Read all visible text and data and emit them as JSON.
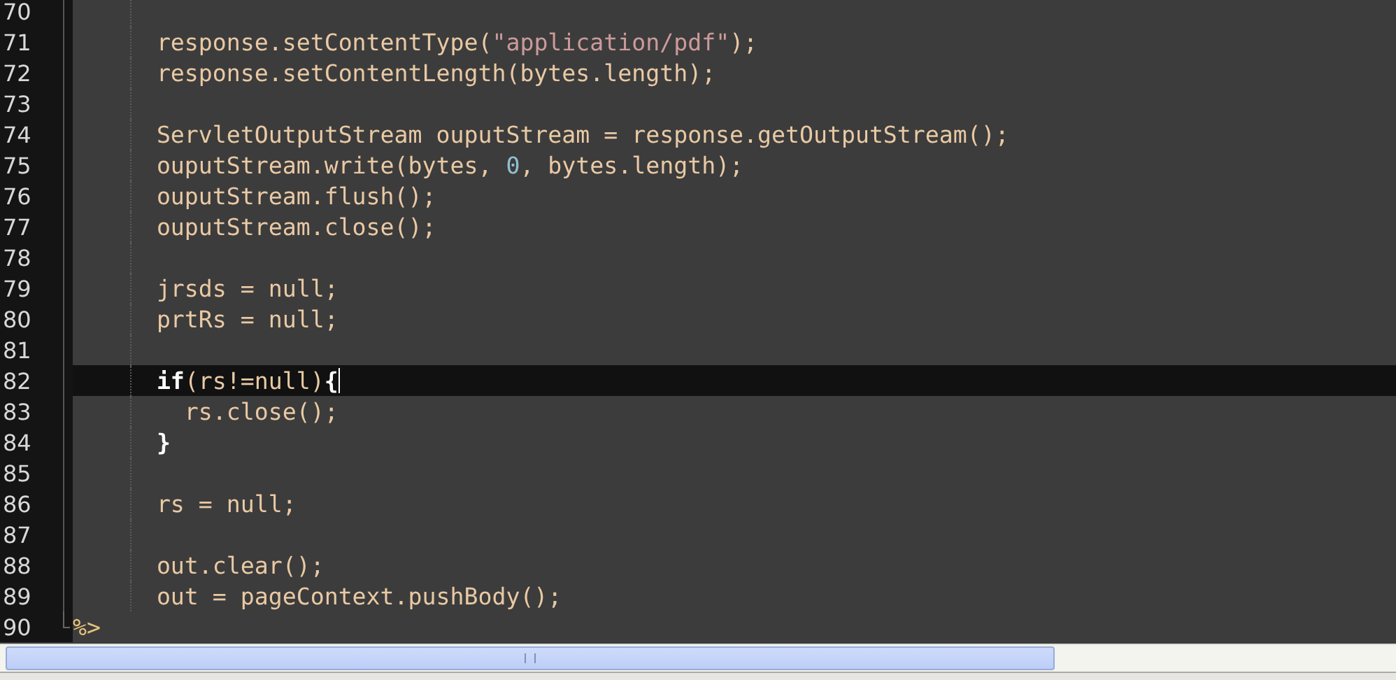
{
  "editor": {
    "lines": [
      {
        "number": "70",
        "current": false
      },
      {
        "number": "71",
        "current": false,
        "tokens": [
          {
            "kind": "plain",
            "text": "      response.setContentType("
          },
          {
            "kind": "string",
            "text": "\"application/pdf\""
          },
          {
            "kind": "plain",
            "text": ");"
          }
        ]
      },
      {
        "number": "72",
        "current": false,
        "tokens": [
          {
            "kind": "plain",
            "text": "      response.setContentLength(bytes.length);"
          }
        ]
      },
      {
        "number": "73",
        "current": false
      },
      {
        "number": "74",
        "current": false,
        "tokens": [
          {
            "kind": "plain",
            "text": "      ServletOutputStream ouputStream = response.getOutputStream();"
          }
        ]
      },
      {
        "number": "75",
        "current": false,
        "tokens": [
          {
            "kind": "plain",
            "text": "      ouputStream.write(bytes, "
          },
          {
            "kind": "number",
            "text": "0"
          },
          {
            "kind": "plain",
            "text": ", bytes.length);"
          }
        ]
      },
      {
        "number": "76",
        "current": false,
        "tokens": [
          {
            "kind": "plain",
            "text": "      ouputStream.flush();"
          }
        ]
      },
      {
        "number": "77",
        "current": false,
        "tokens": [
          {
            "kind": "plain",
            "text": "      ouputStream.close();"
          }
        ]
      },
      {
        "number": "78",
        "current": false
      },
      {
        "number": "79",
        "current": false,
        "tokens": [
          {
            "kind": "plain",
            "text": "      jrsds = null;"
          }
        ]
      },
      {
        "number": "80",
        "current": false,
        "tokens": [
          {
            "kind": "plain",
            "text": "      prtRs = null;"
          }
        ]
      },
      {
        "number": "81",
        "current": false
      },
      {
        "number": "82",
        "current": true,
        "tokens": [
          {
            "kind": "keyword",
            "text": "      if"
          },
          {
            "kind": "plain",
            "text": "(rs!=null)"
          },
          {
            "kind": "keyword",
            "text": "{"
          }
        ]
      },
      {
        "number": "83",
        "current": false,
        "tokens": [
          {
            "kind": "plain",
            "text": "        rs.close();"
          }
        ]
      },
      {
        "number": "84",
        "current": false,
        "tokens": [
          {
            "kind": "keyword",
            "text": "      }"
          }
        ]
      },
      {
        "number": "85",
        "current": false
      },
      {
        "number": "86",
        "current": false,
        "tokens": [
          {
            "kind": "plain",
            "text": "      rs = null;"
          }
        ]
      },
      {
        "number": "87",
        "current": false
      },
      {
        "number": "88",
        "current": false,
        "tokens": [
          {
            "kind": "plain",
            "text": "      out.clear();"
          }
        ]
      },
      {
        "number": "89",
        "current": false,
        "tokens": [
          {
            "kind": "plain",
            "text": "      out = pageContext.pushBody();"
          }
        ]
      },
      {
        "number": "90",
        "current": false,
        "fold_end": true,
        "tokens": [
          {
            "kind": "tag",
            "text": "%>"
          }
        ]
      }
    ]
  }
}
